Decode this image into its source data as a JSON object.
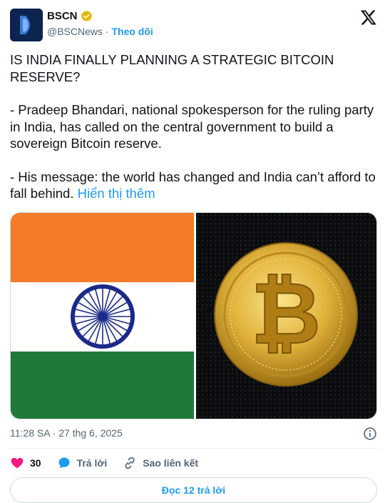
{
  "account": {
    "name": "BSCN",
    "handle": "@BSCNews",
    "separator": "·",
    "follow_label": "Theo dõi"
  },
  "tweet": {
    "paragraphs": [
      "IS INDIA FINALLY PLANNING A STRATEGIC BITCOIN RESERVE?",
      "- Pradeep Bhandari, national spokesperson for the ruling party in India, has called on the central government to build a sovereign Bitcoin reserve.",
      "- His message: the world has changed and India can’t afford to fall behind."
    ],
    "show_more_label": "Hiển thị thêm"
  },
  "media": {
    "left_image": "india-flag",
    "right_image": "bitcoin-coin",
    "colors": {
      "saffron": "#f47b2a",
      "white": "#ffffff",
      "green": "#1f7a3a",
      "chakra": "#1b2a8a",
      "gold": "#e2b33c"
    }
  },
  "meta": {
    "timestamp": "11:28 SA · 27 thg 6, 2025"
  },
  "actions": {
    "likes": "30",
    "reply_label": "Trả lời",
    "copy_link_label": "Sao liên kết"
  },
  "read_replies_label": "Đọc 12 trả lời",
  "colors": {
    "accent": "#1d9bf0",
    "like": "#f91880",
    "verified": "#e7b400"
  }
}
